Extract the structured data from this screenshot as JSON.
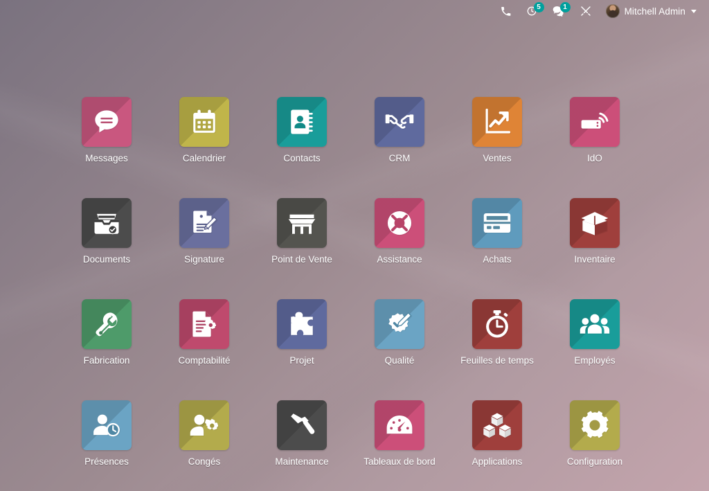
{
  "systray": {
    "items": [
      {
        "icon": "phone-icon",
        "name": "phone",
        "badge": null
      },
      {
        "icon": "activity-clock-icon",
        "name": "activities",
        "badge": "5"
      },
      {
        "icon": "messages-bubble-icon",
        "name": "messages",
        "badge": "1"
      },
      {
        "icon": "developer-tools-icon",
        "name": "developer-tools",
        "badge": null
      }
    ],
    "user": {
      "name": "Mitchell Admin",
      "avatar": "user-avatar",
      "caret": "chevron-down-icon"
    }
  },
  "apps": [
    {
      "label": "Messages",
      "icon": "chat-bubble-icon",
      "color": "#c9577f"
    },
    {
      "label": "Calendrier",
      "icon": "calendar-icon",
      "color": "#c0b54a"
    },
    {
      "label": "Contacts",
      "icon": "address-book-icon",
      "color": "#199d9a"
    },
    {
      "label": "CRM",
      "icon": "handshake-icon",
      "color": "#5f6a9e"
    },
    {
      "label": "Ventes",
      "icon": "trending-up-icon",
      "color": "#df8436"
    },
    {
      "label": "IdO",
      "icon": "iot-box-icon",
      "color": "#cc4f79"
    },
    {
      "label": "Documents",
      "icon": "file-tray-check-icon",
      "color": "#4c4c4c"
    },
    {
      "label": "Signature",
      "icon": "sign-document-icon",
      "color": "#6a6f9e"
    },
    {
      "label": "Point de Vente",
      "icon": "storefront-icon",
      "color": "#54544f"
    },
    {
      "label": "Assistance",
      "icon": "lifebuoy-icon",
      "color": "#cc4f79"
    },
    {
      "label": "Achats",
      "icon": "credit-card-icon",
      "color": "#5f9bbd"
    },
    {
      "label": "Inventaire",
      "icon": "open-box-icon",
      "color": "#9f3f3c"
    },
    {
      "label": "Fabrication",
      "icon": "wrench-icon",
      "color": "#4e9b6a"
    },
    {
      "label": "Comptabilité",
      "icon": "invoice-gear-icon",
      "color": "#bf4a6d"
    },
    {
      "label": "Projet",
      "icon": "puzzle-piece-icon",
      "color": "#5f6a9e"
    },
    {
      "label": "Qualité",
      "icon": "quality-seal-icon",
      "color": "#6ba4c4"
    },
    {
      "label": "Feuilles de temps",
      "icon": "stopwatch-icon",
      "color": "#9f3f3c"
    },
    {
      "label": "Employés",
      "icon": "people-group-icon",
      "color": "#199d9a"
    },
    {
      "label": "Présences",
      "icon": "person-clock-icon",
      "color": "#6ba4c4"
    },
    {
      "label": "Congés",
      "icon": "person-gear-icon",
      "color": "#b3ab4c"
    },
    {
      "label": "Maintenance",
      "icon": "hammer-icon",
      "color": "#4c4c4c"
    },
    {
      "label": "Tableaux de bord",
      "icon": "gauge-icon",
      "color": "#cc4f79"
    },
    {
      "label": "Applications",
      "icon": "cubes-icon",
      "color": "#9f3f3c"
    },
    {
      "label": "Configuration",
      "icon": "gear-icon",
      "color": "#b3ab4c"
    }
  ]
}
